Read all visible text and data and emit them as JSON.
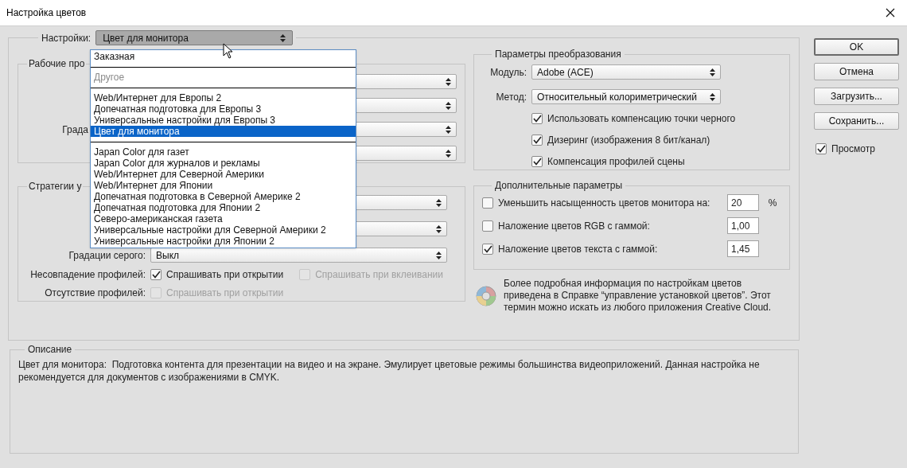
{
  "window": {
    "title": "Настройка цветов"
  },
  "settings": {
    "label": "Настройки:",
    "value": "Цвет для монитора"
  },
  "settings_menu": {
    "items": [
      {
        "kind": "item",
        "label": "Заказная",
        "disabled": false,
        "selected": false
      },
      {
        "kind": "separator"
      },
      {
        "kind": "item",
        "label": "Другое",
        "disabled": true,
        "selected": false
      },
      {
        "kind": "separator"
      },
      {
        "kind": "item",
        "label": "Web/Интернет для Европы 2",
        "disabled": false,
        "selected": false
      },
      {
        "kind": "item",
        "label": "Допечатная подготовка для Европы 3",
        "disabled": false,
        "selected": false
      },
      {
        "kind": "item",
        "label": "Универсальные настройки для Европы 3",
        "disabled": false,
        "selected": false
      },
      {
        "kind": "item",
        "label": "Цвет для монитора",
        "disabled": false,
        "selected": true
      },
      {
        "kind": "separator"
      },
      {
        "kind": "item",
        "label": "Japan Color для газет",
        "disabled": false,
        "selected": false
      },
      {
        "kind": "item",
        "label": "Japan Color для журналов и рекламы",
        "disabled": false,
        "selected": false
      },
      {
        "kind": "item",
        "label": "Web/Интернет для Северной Америки",
        "disabled": false,
        "selected": false
      },
      {
        "kind": "item",
        "label": "Web/Интернет для Японии",
        "disabled": false,
        "selected": false
      },
      {
        "kind": "item",
        "label": "Допечатная подготовка в Северной Америке 2",
        "disabled": false,
        "selected": false
      },
      {
        "kind": "item",
        "label": "Допечатная подготовка для Японии 2",
        "disabled": false,
        "selected": false
      },
      {
        "kind": "item",
        "label": "Северо-американская газета",
        "disabled": false,
        "selected": false
      },
      {
        "kind": "item",
        "label": "Универсальные настройки для Северной Америки 2",
        "disabled": false,
        "selected": false
      },
      {
        "kind": "item",
        "label": "Универсальные настройки для Японии 2",
        "disabled": false,
        "selected": false
      }
    ]
  },
  "working_spaces": {
    "title": "Рабочие про",
    "rows": [
      {
        "kind": "select"
      },
      {
        "kind": "select"
      },
      {
        "kind": "select",
        "label": "Града"
      },
      {
        "kind": "select"
      }
    ]
  },
  "color_management": {
    "title": "Стратегии у",
    "rows": [
      {
        "kind": "select"
      },
      {
        "kind": "select"
      },
      {
        "kind": "select",
        "label": "Градации серого:",
        "value": "Выкл"
      }
    ],
    "checks": [
      {
        "label": "Несовпадение профилей:",
        "options": [
          {
            "label": "Спрашивать при открытии",
            "checked": true,
            "disabled": false
          },
          {
            "label": "Спрашивать при вклеивании",
            "checked": false,
            "disabled": true
          }
        ]
      },
      {
        "label": "Отсутствие профилей:",
        "options": [
          {
            "label": "Спрашивать при открытии",
            "checked": false,
            "disabled": true
          }
        ]
      }
    ]
  },
  "conversion": {
    "title": "Параметры преобразования",
    "engine": {
      "label": "Модуль:",
      "value": "Adobe (ACE)"
    },
    "intent": {
      "label": "Метод:",
      "value": "Относительный колориметрический"
    },
    "options": [
      {
        "label": "Использовать компенсацию точки черного",
        "checked": true
      },
      {
        "label": "Дизеринг (изображения 8 бит/канал)",
        "checked": true
      },
      {
        "label": "Компенсация профилей сцены",
        "checked": true
      }
    ]
  },
  "advanced": {
    "title": "Дополнительные параметры",
    "rows": [
      {
        "label": "Уменьшить насыщенность цветов монитора на:",
        "checked": false,
        "value": "20",
        "unit": "%"
      },
      {
        "label": "Наложение цветов RGB с гаммой:",
        "checked": false,
        "value": "1,00"
      },
      {
        "label": "Наложение цветов текста с гаммой:",
        "checked": true,
        "value": "1,45"
      }
    ]
  },
  "info": {
    "text": "Более подробная информация по настройкам цветов приведена в Справке “управление установкой цветов”. Этот термин можно искать из любого приложения Creative Cloud."
  },
  "buttons": [
    {
      "label": "OK",
      "default": true
    },
    {
      "label": "Отмена",
      "default": false
    },
    {
      "label": "Загрузить...",
      "default": false
    },
    {
      "label": "Сохранить...",
      "default": false
    }
  ],
  "preview": {
    "label": "Просмотр",
    "checked": true
  },
  "description": {
    "title": "Описание",
    "text": "Цвет для монитора:  Подготовка контента для презентации на видео и на экране. Эмулирует цветовые режимы большинства видеоприложений. Данная настройка не рекомендуется для документов с изображениями в CMYK."
  }
}
